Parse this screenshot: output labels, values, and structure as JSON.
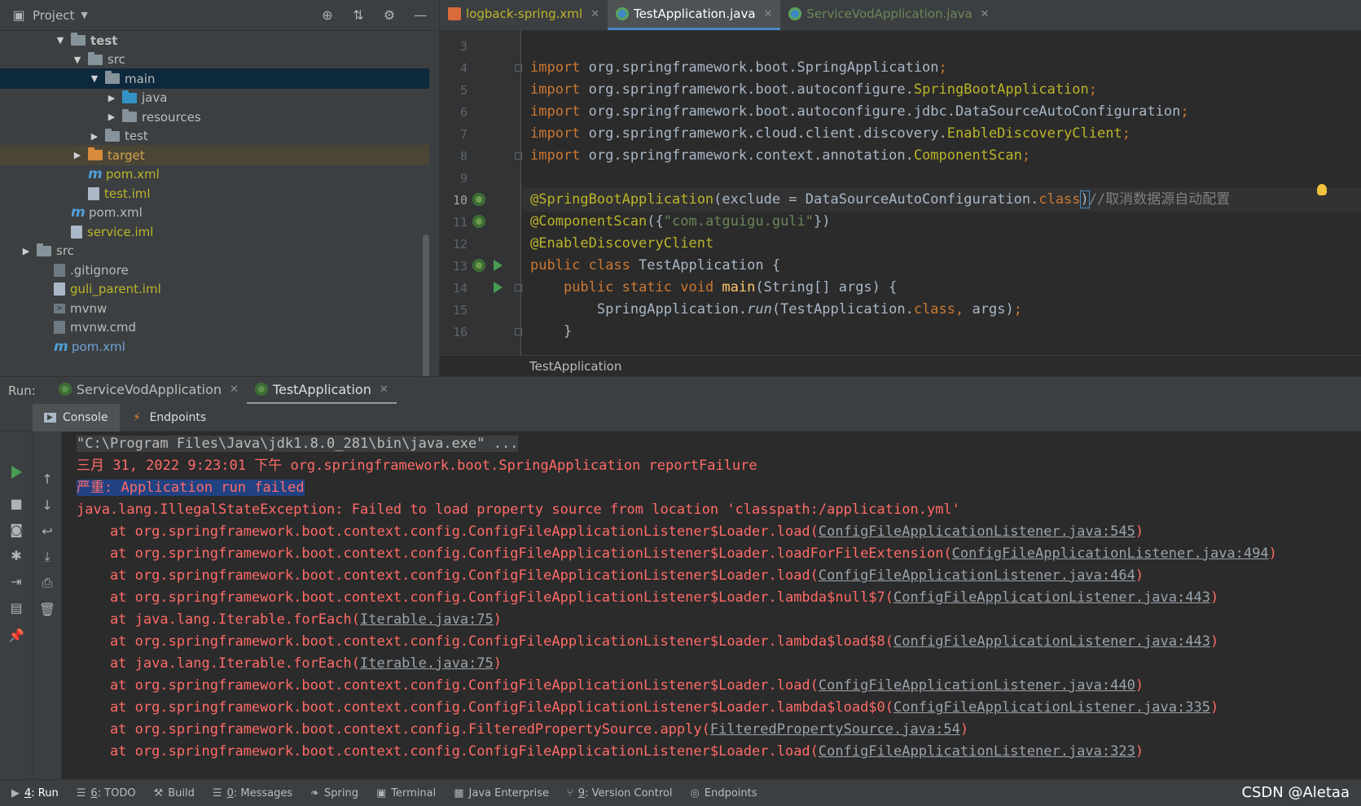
{
  "project": {
    "title": "Project",
    "tree": [
      {
        "label": "test",
        "indent": 3,
        "kind": "folder",
        "open": true,
        "bold": true
      },
      {
        "label": "src",
        "indent": 4,
        "kind": "folder",
        "open": true
      },
      {
        "label": "main",
        "indent": 5,
        "kind": "folder",
        "open": true,
        "selected": true
      },
      {
        "label": "java",
        "indent": 6,
        "kind": "folder-blue",
        "open": false
      },
      {
        "label": "resources",
        "indent": 6,
        "kind": "folder",
        "open": false
      },
      {
        "label": "test",
        "indent": 5,
        "kind": "folder",
        "open": false
      },
      {
        "label": "target",
        "indent": 4,
        "kind": "folder-orange",
        "open": false,
        "color": "orange",
        "target": true
      },
      {
        "label": "pom.xml",
        "indent": 4,
        "kind": "mvn",
        "color": "yellow"
      },
      {
        "label": "test.iml",
        "indent": 4,
        "kind": "file",
        "color": "yellow"
      },
      {
        "label": "pom.xml",
        "indent": 3,
        "kind": "mvn"
      },
      {
        "label": "service.iml",
        "indent": 3,
        "kind": "file",
        "color": "yellow"
      },
      {
        "label": "src",
        "indent": 1,
        "kind": "folder",
        "open": false
      },
      {
        "label": ".gitignore",
        "indent": 2,
        "kind": "file-dark"
      },
      {
        "label": "guli_parent.iml",
        "indent": 2,
        "kind": "file",
        "color": "yellow"
      },
      {
        "label": "mvnw",
        "indent": 2,
        "kind": "term"
      },
      {
        "label": "mvnw.cmd",
        "indent": 2,
        "kind": "file-dark"
      },
      {
        "label": "pom.xml",
        "indent": 2,
        "kind": "mvn",
        "color": "blue"
      }
    ]
  },
  "editor": {
    "tabs": [
      {
        "label": "logback-spring.xml",
        "icon": "xml-icon",
        "active": false,
        "color": "#bbb529"
      },
      {
        "label": "TestApplication.java",
        "icon": "java-class-icon",
        "active": true,
        "color": "#6897bb"
      },
      {
        "label": "ServiceVodApplication.java",
        "icon": "java-class-icon",
        "active": false,
        "color": "#6a8759"
      }
    ],
    "lines": [
      {
        "n": "3",
        "html": ""
      },
      {
        "n": "4",
        "html": "<span class='kw'>import </span>org.springframework.boot.SpringApplication<span class='kw'>;</span>"
      },
      {
        "n": "5",
        "html": "<span class='kw'>import </span>org.springframework.boot.autoconfigure.<span class='ann'>SpringBootApplication</span><span class='kw'>;</span>"
      },
      {
        "n": "6",
        "html": "<span class='kw'>import </span>org.springframework.boot.autoconfigure.jdbc.DataSourceAutoConfiguration<span class='kw'>;</span>"
      },
      {
        "n": "7",
        "html": "<span class='kw'>import </span>org.springframework.cloud.client.discovery.<span class='ann'>EnableDiscoveryClient</span><span class='kw'>;</span>"
      },
      {
        "n": "8",
        "html": "<span class='kw'>import </span>org.springframework.context.annotation.<span class='ann'>ComponentScan</span><span class='kw'>;</span>"
      },
      {
        "n": "9",
        "html": ""
      },
      {
        "n": "10",
        "html": "<span class='ann'>@SpringBootApplication</span>(exclude = DataSourceAutoConfiguration.<span class='kw'>class</span><span class='caret-box'>)</span><span class='cmt'>//取消数据源自动配置</span>",
        "cur": true
      },
      {
        "n": "11",
        "html": "<span class='ann'>@ComponentScan</span>({<span class='str'>\"com.atguigu.guli\"</span>})"
      },
      {
        "n": "12",
        "html": "<span class='ann'>@EnableDiscoveryClient</span>"
      },
      {
        "n": "13",
        "html": "<span class='kw'>public class </span>TestApplication {"
      },
      {
        "n": "14",
        "html": "    <span class='kw'>public static void </span><span class='fn'>main</span>(String[] args) {"
      },
      {
        "n": "15",
        "html": "        SpringApplication.<span class='itc'>run</span>(TestApplication.<span class='kw'>class</span><span class='kw'>, </span>args)<span class='kw'>;</span>"
      },
      {
        "n": "16",
        "html": "    }"
      }
    ],
    "breadcrumb": "TestApplication"
  },
  "run": {
    "label": "Run:",
    "tabs": [
      {
        "label": "ServiceVodApplication",
        "active": false
      },
      {
        "label": "TestApplication",
        "active": true
      }
    ],
    "console_tabs": [
      {
        "label": "Console",
        "active": true
      },
      {
        "label": "Endpoints",
        "active": false
      }
    ],
    "output": [
      {
        "text": "\"C:\\Program Files\\Java\\jdk1.8.0_281\\bin\\java.exe\" ...",
        "type": "cmd"
      },
      {
        "text": "三月 31, 2022 9:23:01 下午 org.springframework.boot.SpringApplication reportFailure",
        "type": "err"
      },
      {
        "text": "严重: Application run failed",
        "type": "highlight"
      },
      {
        "text": "java.lang.IllegalStateException: Failed to load property source from location 'classpath:/application.yml'",
        "type": "err"
      },
      {
        "prefix": "    at org.springframework.boot.context.config.ConfigFileApplicationListener$Loader.load(",
        "link": "ConfigFileApplicationListener.java:545",
        "suffix": ")"
      },
      {
        "prefix": "    at org.springframework.boot.context.config.ConfigFileApplicationListener$Loader.loadForFileExtension(",
        "link": "ConfigFileApplicationListener.java:494",
        "suffix": ")"
      },
      {
        "prefix": "    at org.springframework.boot.context.config.ConfigFileApplicationListener$Loader.load(",
        "link": "ConfigFileApplicationListener.java:464",
        "suffix": ")"
      },
      {
        "prefix": "    at org.springframework.boot.context.config.ConfigFileApplicationListener$Loader.lambda$null$7(",
        "link": "ConfigFileApplicationListener.java:443",
        "suffix": ")"
      },
      {
        "prefix": "    at java.lang.Iterable.forEach(",
        "link": "Iterable.java:75",
        "suffix": ")"
      },
      {
        "prefix": "    at org.springframework.boot.context.config.ConfigFileApplicationListener$Loader.lambda$load$8(",
        "link": "ConfigFileApplicationListener.java:443",
        "suffix": ")"
      },
      {
        "prefix": "    at java.lang.Iterable.forEach(",
        "link": "Iterable.java:75",
        "suffix": ")"
      },
      {
        "prefix": "    at org.springframework.boot.context.config.ConfigFileApplicationListener$Loader.load(",
        "link": "ConfigFileApplicationListener.java:440",
        "suffix": ")"
      },
      {
        "prefix": "    at org.springframework.boot.context.config.ConfigFileApplicationListener$Loader.lambda$load$0(",
        "link": "ConfigFileApplicationListener.java:335",
        "suffix": ")"
      },
      {
        "prefix": "    at org.springframework.boot.context.config.FilteredPropertySource.apply(",
        "link": "FilteredPropertySource.java:54",
        "suffix": ")"
      },
      {
        "prefix": "    at org.springframework.boot.context.config.ConfigFileApplicationListener$Loader.load(",
        "link": "ConfigFileApplicationListener.java:323",
        "suffix": ")"
      }
    ]
  },
  "statusbar": {
    "items": [
      {
        "num": "4",
        "label": ": Run",
        "icon": "run-icon",
        "active": true
      },
      {
        "num": "6",
        "label": ": TODO",
        "icon": "todo-icon"
      },
      {
        "num": "",
        "label": "Build",
        "icon": "hammer-icon"
      },
      {
        "num": "0",
        "label": ": Messages",
        "icon": "messages-icon"
      },
      {
        "num": "",
        "label": "Spring",
        "icon": "spring-icon"
      },
      {
        "num": "",
        "label": "Terminal",
        "icon": "terminal-icon"
      },
      {
        "num": "",
        "label": "Java Enterprise",
        "icon": "java-enterprise-icon"
      },
      {
        "num": "9",
        "label": ": Version Control",
        "icon": "version-control-icon"
      },
      {
        "num": "",
        "label": "Endpoints",
        "icon": "endpoints-icon"
      }
    ],
    "watermark": "CSDN @Aletaa"
  }
}
